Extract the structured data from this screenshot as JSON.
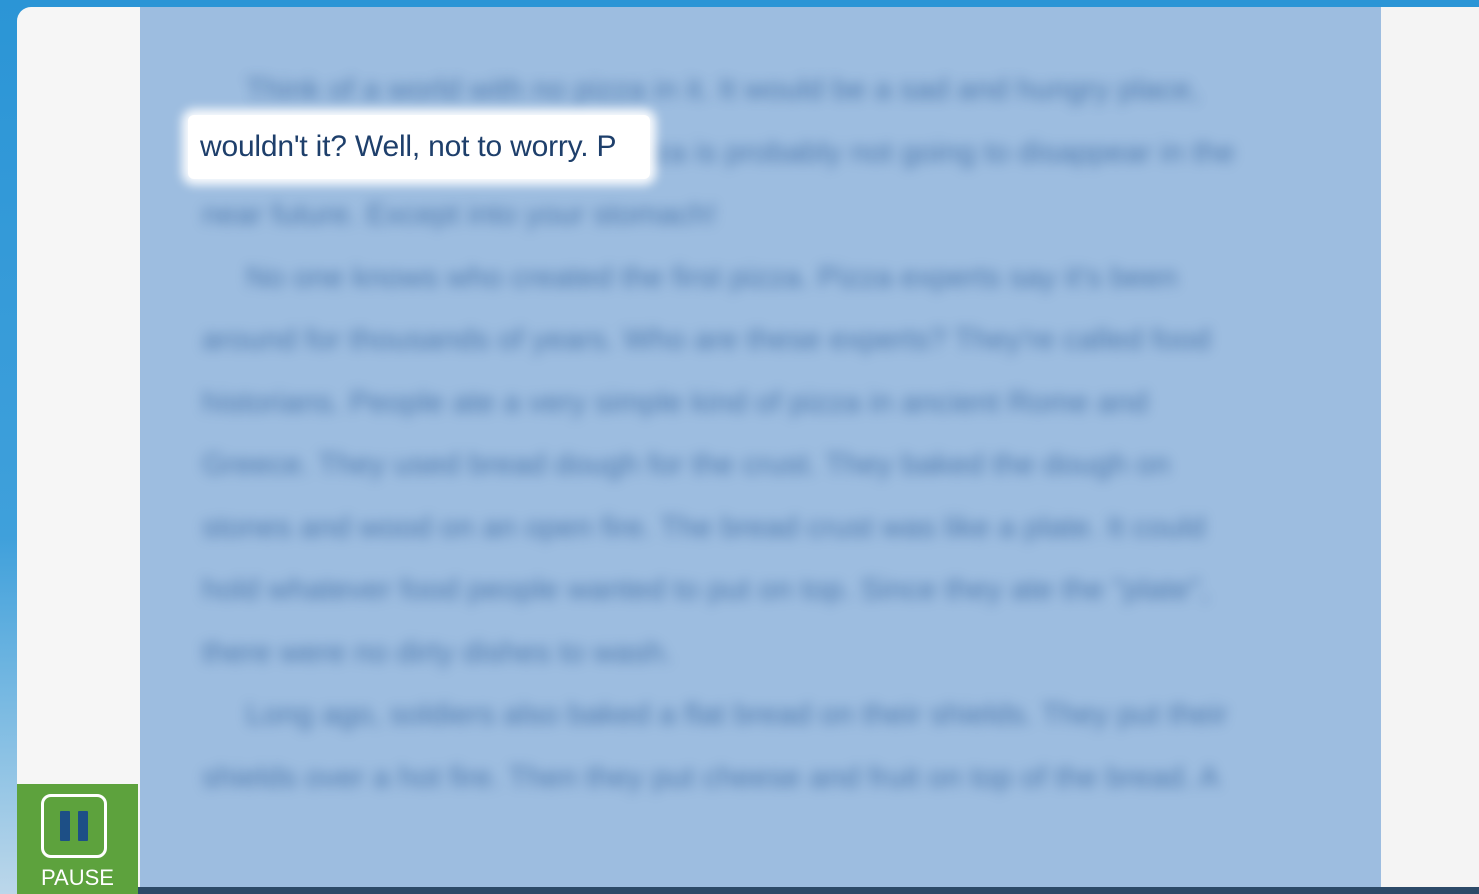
{
  "reader": {
    "visible_phrase": "wouldn't it? Well, not to worry. P"
  },
  "controls": {
    "pause_label": "PAUSE"
  },
  "colors": {
    "accent_green": "#5da23d",
    "panel_blue": "#9dbde0",
    "frame_blue": "#2b95d6"
  },
  "icons": {
    "pause": "pause-icon"
  }
}
